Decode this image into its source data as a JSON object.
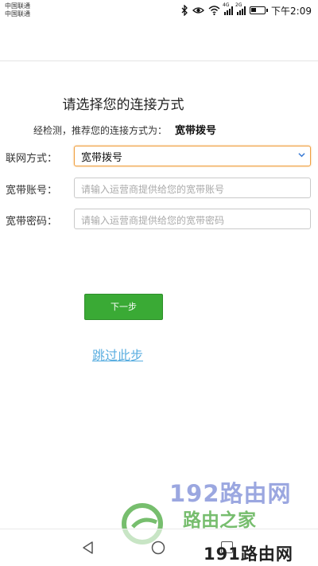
{
  "statusbar": {
    "carrier_1": "中国联通",
    "carrier_2": "中国联通",
    "net_1": "4G",
    "net_2": "2G",
    "time": "下午2:09"
  },
  "form": {
    "title": "请选择您的连接方式",
    "hint_prefix": "经检测，推荐您的连接方式为：",
    "hint_value": "宽带拨号",
    "connection_label": "联网方式：",
    "connection_value": "宽带拨号",
    "account_label": "宽带账号：",
    "account_placeholder": "请输入运营商提供给您的宽带账号",
    "password_label": "宽带密码：",
    "password_placeholder": "请输入运营商提供给您的宽带密码"
  },
  "actions": {
    "next_label": "下一步",
    "skip_label": "跳过此步"
  },
  "watermark": {
    "site_1": "192路由网",
    "site_2": "路由之家",
    "site_3": "191路由网"
  },
  "colors": {
    "accent_green": "#3aaa35",
    "link_blue": "#5aaee0",
    "select_border": "#f0a040"
  }
}
